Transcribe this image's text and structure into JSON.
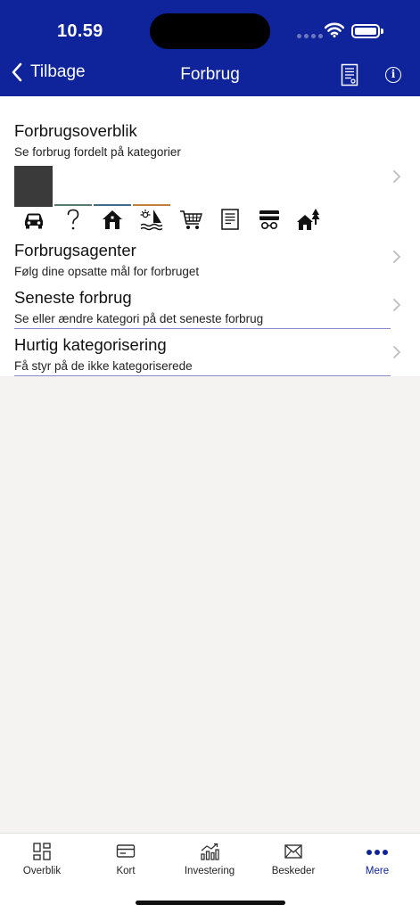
{
  "status_bar": {
    "time": "10.59"
  },
  "nav": {
    "back_label": "Tilbage",
    "title": "Forbrug"
  },
  "overview": {
    "title": "Forbrugsoverblik",
    "subtitle": "Se forbrug fordelt på kategorier"
  },
  "agents": {
    "title": "Forbrugsagenter",
    "subtitle": "Følg dine opsatte mål for forbruget"
  },
  "recent": {
    "title": "Seneste forbrug",
    "subtitle": "Se eller ændre kategori på det seneste forbrug"
  },
  "quick": {
    "title": "Hurtig kategorisering",
    "subtitle": "Få styr på de ikke kategoriserede"
  },
  "category_icons": [
    "car-icon",
    "question-icon",
    "house-icon",
    "leisure-icon",
    "shopping-cart-icon",
    "document-icon",
    "transport-icon",
    "home-tree-icon"
  ],
  "bar_colors": [
    "#5b7a6e",
    "#3f6a8a",
    "#c0803a"
  ],
  "colors": {
    "brand": "#0f239a",
    "divider": "#8a8cc8"
  },
  "tabs": [
    {
      "label": "Overblik",
      "icon": "grid-icon"
    },
    {
      "label": "Kort",
      "icon": "card-icon"
    },
    {
      "label": "Investering",
      "icon": "chart-icon"
    },
    {
      "label": "Beskeder",
      "icon": "mail-icon"
    },
    {
      "label": "Mere",
      "icon": "more-icon",
      "active": true
    }
  ]
}
